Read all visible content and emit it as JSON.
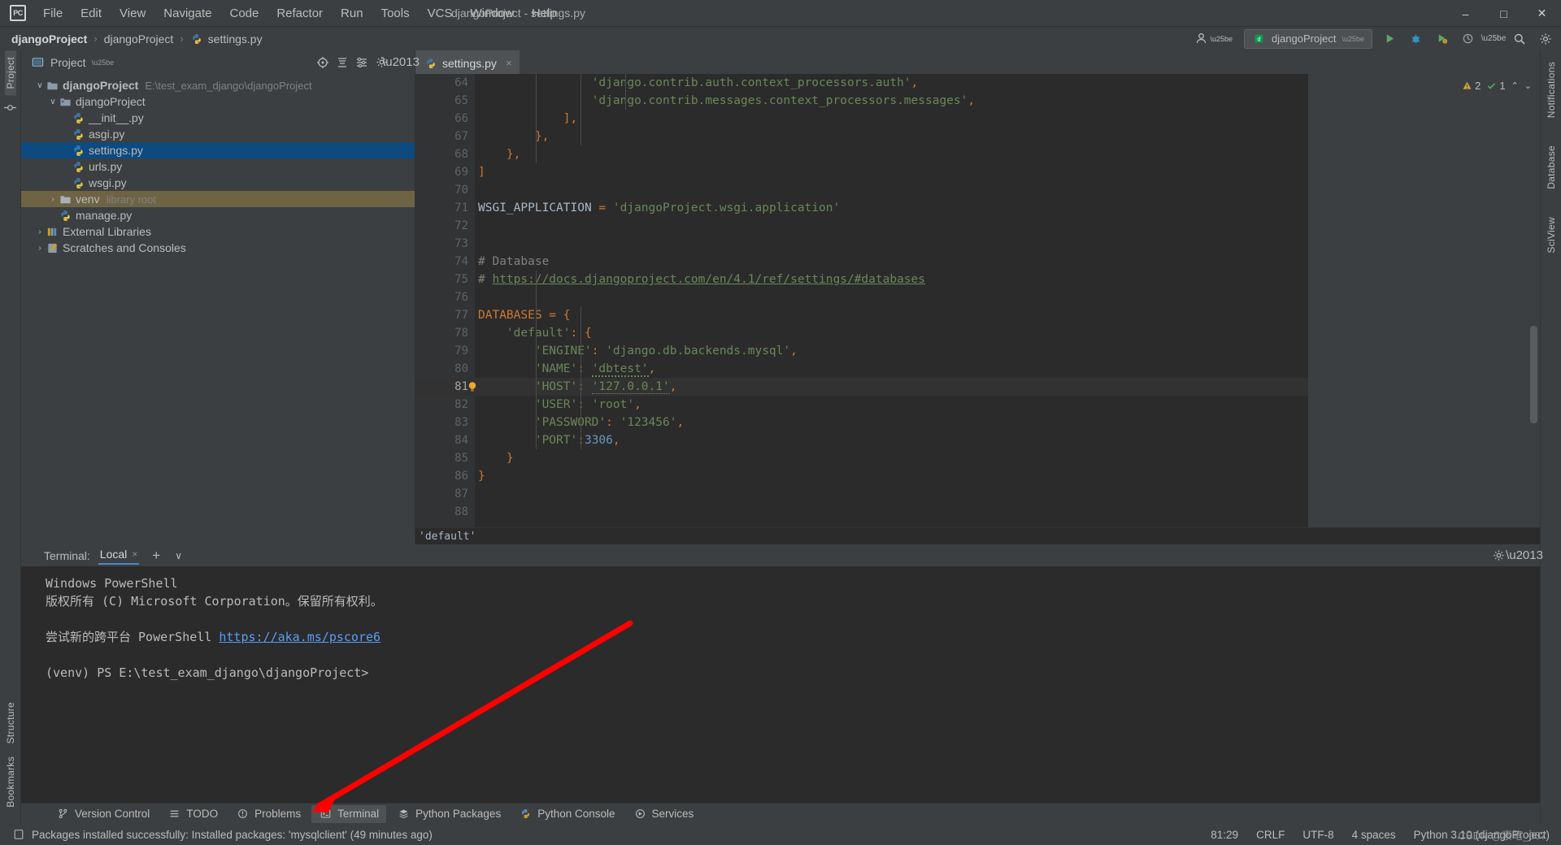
{
  "window": {
    "title": "djangoProject - settings.py",
    "app_icon": "PC",
    "minimize": "–",
    "maximize": "□",
    "close": "✕"
  },
  "menu": [
    {
      "label": "File"
    },
    {
      "label": "Edit"
    },
    {
      "label": "View"
    },
    {
      "label": "Navigate"
    },
    {
      "label": "Code"
    },
    {
      "label": "Refactor"
    },
    {
      "label": "Run"
    },
    {
      "label": "Tools"
    },
    {
      "label": "VCS"
    },
    {
      "label": "Window"
    },
    {
      "label": "Help"
    }
  ],
  "breadcrumb": {
    "items": [
      "djangoProject",
      "djangoProject",
      "settings.py"
    ],
    "separator": "›"
  },
  "toolbar_right": {
    "run_config": "djangoProject",
    "chevron": "▾",
    "search_icon": "search-icon",
    "settings_icon": "gear-icon",
    "run_icon": "run-icon",
    "debug_icon": "debug-icon",
    "coverage_icon": "coverage-icon",
    "profile_icon": "profile-icon",
    "more_icon": "more-icon"
  },
  "left_rail": {
    "top": [
      "Project"
    ],
    "bottom": [
      "Structure",
      "Bookmarks"
    ]
  },
  "right_rail": {
    "items": [
      "Notifications",
      "Database",
      "SciView"
    ]
  },
  "project_panel": {
    "title": "Project",
    "chevron": "▾",
    "icons": [
      "target-icon",
      "collapse-all-icon",
      "settings-icon",
      "hide-icon"
    ],
    "tree": [
      {
        "label": "djangoProject",
        "sub": "E:\\test_exam_django\\djangoProject",
        "indent": 0,
        "arrow": "∨",
        "icon": "folder-root",
        "bold": true,
        "state": "normal"
      },
      {
        "label": "djangoProject",
        "sub": "",
        "indent": 1,
        "arrow": "∨",
        "icon": "folder-module",
        "bold": false,
        "state": "normal"
      },
      {
        "label": "__init__.py",
        "sub": "",
        "indent": 2,
        "arrow": "",
        "icon": "python-file",
        "bold": false,
        "state": "normal"
      },
      {
        "label": "asgi.py",
        "sub": "",
        "indent": 2,
        "arrow": "",
        "icon": "python-file",
        "bold": false,
        "state": "normal"
      },
      {
        "label": "settings.py",
        "sub": "",
        "indent": 2,
        "arrow": "",
        "icon": "python-file",
        "bold": false,
        "state": "selected"
      },
      {
        "label": "urls.py",
        "sub": "",
        "indent": 2,
        "arrow": "",
        "icon": "python-file",
        "bold": false,
        "state": "normal"
      },
      {
        "label": "wsgi.py",
        "sub": "",
        "indent": 2,
        "arrow": "",
        "icon": "python-file",
        "bold": false,
        "state": "normal"
      },
      {
        "label": "venv",
        "sub": "library root",
        "indent": 1,
        "arrow": "›",
        "icon": "folder-venv",
        "bold": false,
        "state": "highlight"
      },
      {
        "label": "manage.py",
        "sub": "",
        "indent": 1,
        "arrow": "",
        "icon": "python-file",
        "bold": false,
        "state": "normal"
      },
      {
        "label": "External Libraries",
        "sub": "",
        "indent": 0,
        "arrow": "›",
        "icon": "library-icon",
        "bold": false,
        "state": "normal"
      },
      {
        "label": "Scratches and Consoles",
        "sub": "",
        "indent": 0,
        "arrow": "›",
        "icon": "scratch-icon",
        "bold": false,
        "state": "normal"
      }
    ]
  },
  "editor": {
    "tab": {
      "label": "settings.py",
      "close": "×",
      "icon": "python-file"
    },
    "inspections": {
      "warnings": "2",
      "warn_icon": "warning-triangle-icon",
      "oks": "1",
      "ok_icon": "check-icon",
      "up": "⌃",
      "down": "⌄"
    },
    "first_line_number": 64,
    "lines": [
      {
        "n": 64,
        "text": "                'django.contrib.auth.context_processors.auth',",
        "type": "string_item"
      },
      {
        "n": 65,
        "text": "                'django.contrib.messages.context_processors.messages',",
        "type": "string_item"
      },
      {
        "n": 66,
        "text": "            ],",
        "type": "plain"
      },
      {
        "n": 67,
        "text": "        },",
        "type": "plain"
      },
      {
        "n": 68,
        "text": "    },",
        "type": "plain"
      },
      {
        "n": 69,
        "text": "]",
        "type": "plain"
      },
      {
        "n": 70,
        "text": "",
        "type": "plain"
      },
      {
        "n": 71,
        "text": "WSGI_APPLICATION = 'djangoProject.wsgi.application'",
        "type": "assign_string"
      },
      {
        "n": 72,
        "text": "",
        "type": "plain"
      },
      {
        "n": 73,
        "text": "",
        "type": "plain"
      },
      {
        "n": 74,
        "text": "# Database",
        "type": "comment"
      },
      {
        "n": 75,
        "text": "# https://docs.djangoproject.com/en/4.1/ref/settings/#databases",
        "type": "comment_link"
      },
      {
        "n": 76,
        "text": "",
        "type": "plain"
      },
      {
        "n": 77,
        "text": "DATABASES = {",
        "type": "plain"
      },
      {
        "n": 78,
        "text": "    'default': {",
        "type": "key"
      },
      {
        "n": 79,
        "text": "        'ENGINE': 'django.db.backends.mysql',",
        "type": "kv"
      },
      {
        "n": 80,
        "text": "        'NAME': 'dbtest',",
        "type": "kv_wavy"
      },
      {
        "n": 81,
        "text": "        'HOST': '127.0.0.1',",
        "type": "kv_dotted",
        "current": true,
        "bulb": true
      },
      {
        "n": 82,
        "text": "        'USER': 'root',",
        "type": "kv"
      },
      {
        "n": 83,
        "text": "        'PASSWORD': '123456',",
        "type": "kv"
      },
      {
        "n": 84,
        "text": "        'PORT':3306,",
        "type": "kv_num"
      },
      {
        "n": 85,
        "text": "    }",
        "type": "plain"
      },
      {
        "n": 86,
        "text": "}",
        "type": "plain"
      },
      {
        "n": 87,
        "text": "",
        "type": "plain"
      },
      {
        "n": 88,
        "text": "",
        "type": "plain"
      }
    ],
    "code_breadcrumb": "'default'"
  },
  "terminal": {
    "label": "Terminal:",
    "tab": "Local",
    "tab_close": "×",
    "add": "+",
    "chevron": "∨",
    "settings_icon": "gear-icon",
    "minimize_icon": "minimize-icon",
    "lines": [
      "Windows PowerShell",
      "版权所有 (C) Microsoft Corporation。保留所有权利。",
      "",
      "尝试新的跨平台 PowerShell https://aka.ms/pscore6",
      "",
      "(venv) PS E:\\test_exam_django\\djangoProject>"
    ],
    "link_text": "https://aka.ms/pscore6",
    "link_line_index": 3
  },
  "bottom_tools": [
    {
      "label": "Version Control",
      "icon": "branch-icon",
      "active": false
    },
    {
      "label": "TODO",
      "icon": "list-icon",
      "active": false
    },
    {
      "label": "Problems",
      "icon": "error-icon",
      "active": false
    },
    {
      "label": "Terminal",
      "icon": "terminal-icon",
      "active": true
    },
    {
      "label": "Python Packages",
      "icon": "packages-icon",
      "active": false
    },
    {
      "label": "Python Console",
      "icon": "python-icon",
      "active": false
    },
    {
      "label": "Services",
      "icon": "services-icon",
      "active": false
    }
  ],
  "status_bar": {
    "icon": "note-icon",
    "message": "Packages installed successfully: Installed packages: 'mysqlclient' (49 minutes ago)",
    "right": [
      "81:29",
      "CRLF",
      "UTF-8",
      "4 spaces",
      "Python 3.10 (djangoProject)"
    ],
    "watermark": "CSDN @素笔_007"
  },
  "colors": {
    "accent_blue": "#0d4a80",
    "selection_highlight": "#6e6444",
    "string_green": "#6a8759",
    "keyword_orange": "#cc7832",
    "number_blue": "#6897bb",
    "comment_gray": "#808080",
    "annotation_red": "#ff0000",
    "panel_bg": "#3c3f41",
    "editor_bg": "#2b2b2b"
  }
}
